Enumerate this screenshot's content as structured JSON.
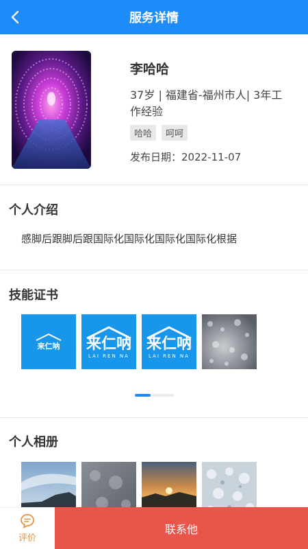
{
  "header": {
    "title": "服务详情",
    "back_icon": "chevron-left-icon"
  },
  "profile": {
    "name": "李哈哈",
    "info": "37岁 | 福建省-福州市人| 3年工作经验",
    "tags": [
      "哈哈",
      "呵呵"
    ],
    "publish_date": "发布日期：2022-11-07"
  },
  "intro": {
    "title": "个人介绍",
    "text": "感脚后跟脚后跟国际化国际化国际化国际化根据"
  },
  "certificates": {
    "title": "技能证书",
    "logo_small": "来仁呐",
    "logo_large": "来仁呐",
    "logo_sub": "LAI REN NA",
    "indicator_progress": 0.4
  },
  "album": {
    "title": "个人相册"
  },
  "bottom_bar": {
    "review_label": "评价",
    "contact_label": "联系他"
  },
  "colors": {
    "header": "#1e8cf8",
    "contact": "#e8554a",
    "review": "#e8933c"
  }
}
